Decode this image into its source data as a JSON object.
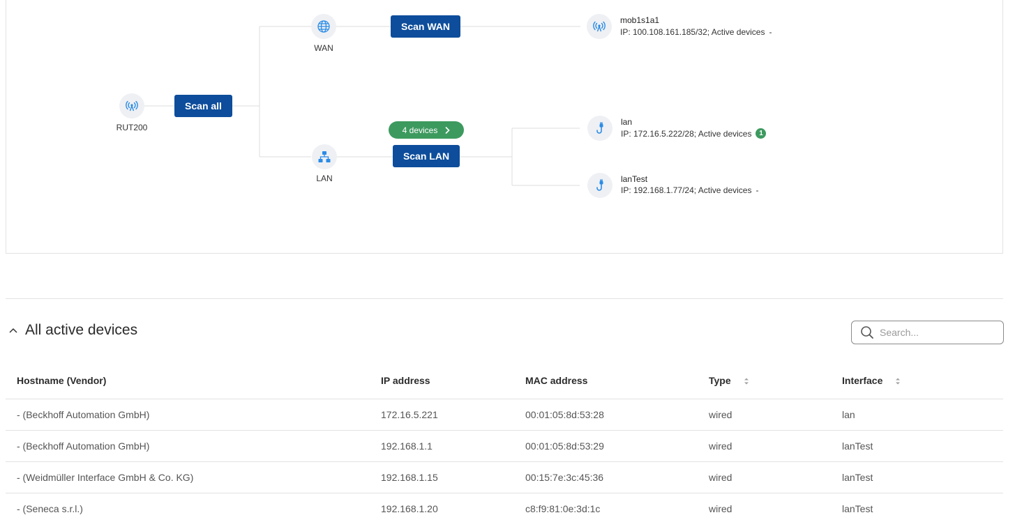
{
  "topology": {
    "router": {
      "label": "RUT200",
      "icon": "antenna-icon"
    },
    "scan_all": "Scan all",
    "wan": {
      "label": "WAN",
      "icon": "globe-icon",
      "scan": "Scan WAN"
    },
    "lan": {
      "label": "LAN",
      "icon": "network-icon",
      "scan": "Scan LAN",
      "devices_pill": "4 devices"
    },
    "interfaces": [
      {
        "name": "mob1s1a1",
        "info": "IP: 100.108.161.185/32; Active devices",
        "active": "-",
        "icon": "antenna-icon"
      },
      {
        "name": "lan",
        "info": "IP: 172.16.5.222/28; Active devices",
        "active": "1",
        "icon": "cable-icon"
      },
      {
        "name": "lanTest",
        "info": "IP: 192.168.1.77/24; Active devices",
        "active": "-",
        "icon": "cable-icon"
      }
    ]
  },
  "devices": {
    "title": "All active devices",
    "search_placeholder": "Search...",
    "columns": [
      "Hostname (Vendor)",
      "IP address",
      "MAC address",
      "Type",
      "Interface"
    ],
    "rows": [
      [
        "- (Beckhoff Automation GmbH)",
        "172.16.5.221",
        "00:01:05:8d:53:28",
        "wired",
        "lan"
      ],
      [
        "- (Beckhoff Automation GmbH)",
        "192.168.1.1",
        "00:01:05:8d:53:29",
        "wired",
        "lanTest"
      ],
      [
        "- (Weidmüller Interface GmbH & Co. KG)",
        "192.168.1.15",
        "00:15:7e:3c:45:36",
        "wired",
        "lanTest"
      ],
      [
        "- (Seneca s.r.l.)",
        "192.168.1.20",
        "c8:f9:81:0e:3d:1c",
        "wired",
        "lanTest"
      ]
    ]
  },
  "colors": {
    "primary": "#0d4d9b",
    "success": "#3d9a5f",
    "icon_blue": "#2a8be6"
  }
}
